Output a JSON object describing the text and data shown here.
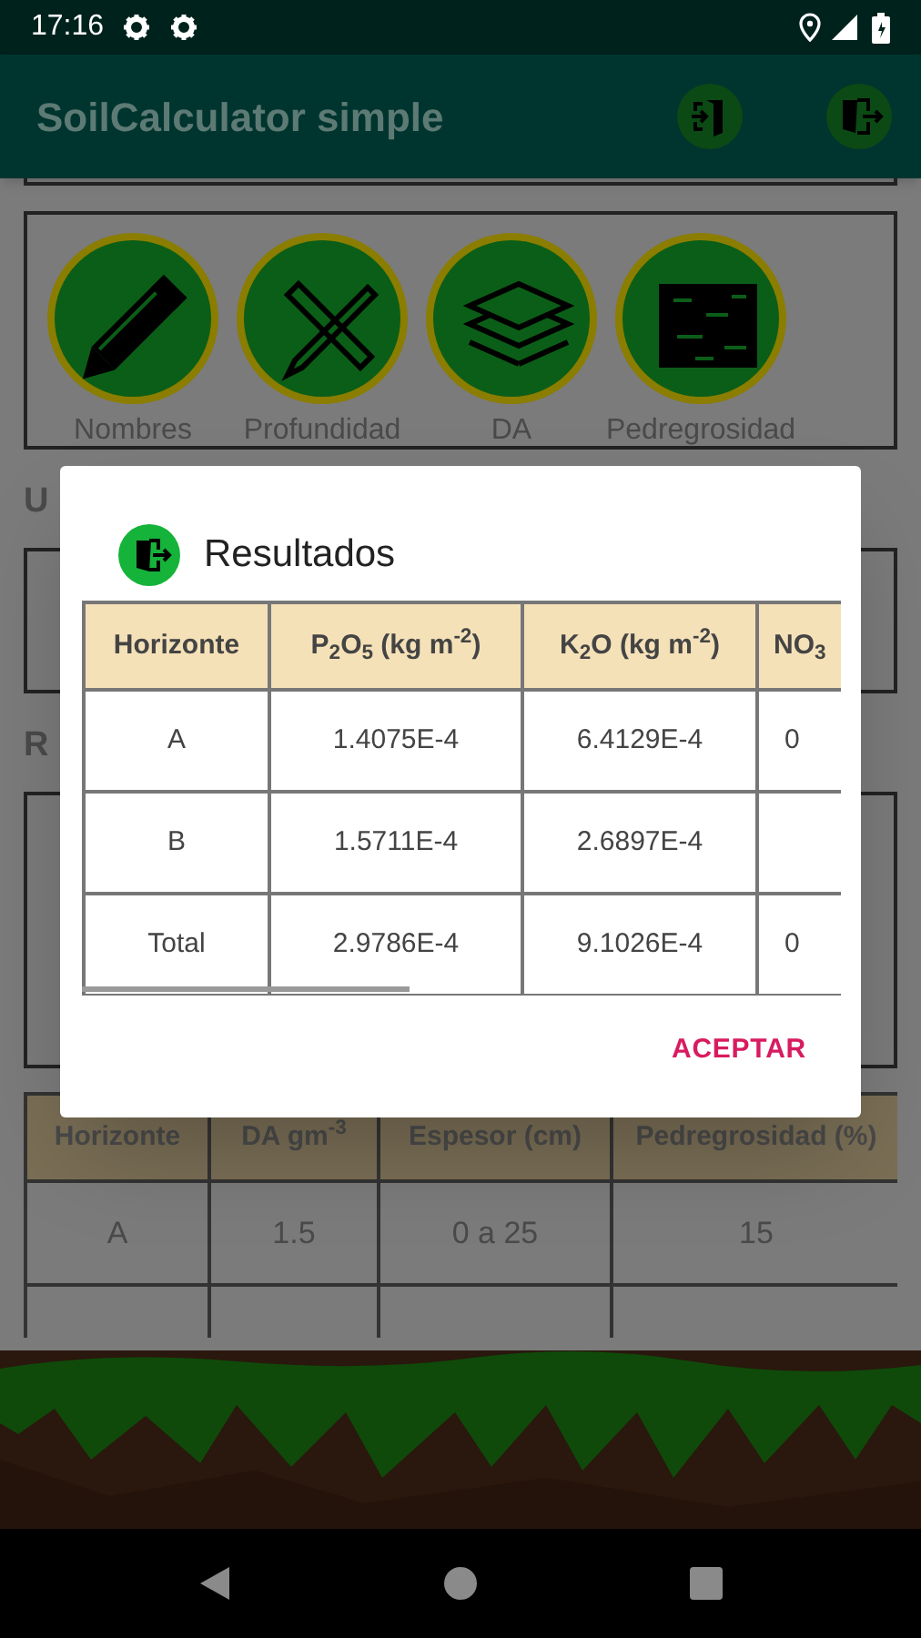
{
  "status_bar": {
    "time": "17:16"
  },
  "app_bar": {
    "title": "SoilCalculator simple"
  },
  "tool_buttons": [
    {
      "label": "Nombres",
      "kind": "pencil"
    },
    {
      "label": "Profundidad",
      "kind": "ruler"
    },
    {
      "label": "DA",
      "kind": "layers"
    },
    {
      "label": "Pedregrosidad",
      "kind": "stones"
    }
  ],
  "section_heading_1": "U",
  "section_heading_2": "R",
  "horizons_table": {
    "columns": [
      "Horizonte",
      "DA gm$^{-3}$",
      "Espesor (cm)",
      "Pedregrosidad (%)"
    ],
    "rows": [
      [
        "A",
        "1.5",
        "0 a 25",
        "15"
      ]
    ]
  },
  "dialog": {
    "title": "Resultados",
    "table": {
      "columns": [
        "Horizonte",
        "P$_{2}$O$_{5}$ (kg m$^{-2}$)",
        "K$_{2}$O (kg m$^{-2}$)",
        "NO$_{3}$"
      ],
      "rows": [
        [
          "A",
          "1.4075E-4",
          "6.4129E-4",
          "0"
        ],
        [
          "B",
          "1.5711E-4",
          "2.6897E-4",
          null
        ],
        [
          "Total",
          "2.9786E-4",
          "9.1026E-4",
          "0"
        ]
      ]
    },
    "button": "ACEPTAR"
  }
}
